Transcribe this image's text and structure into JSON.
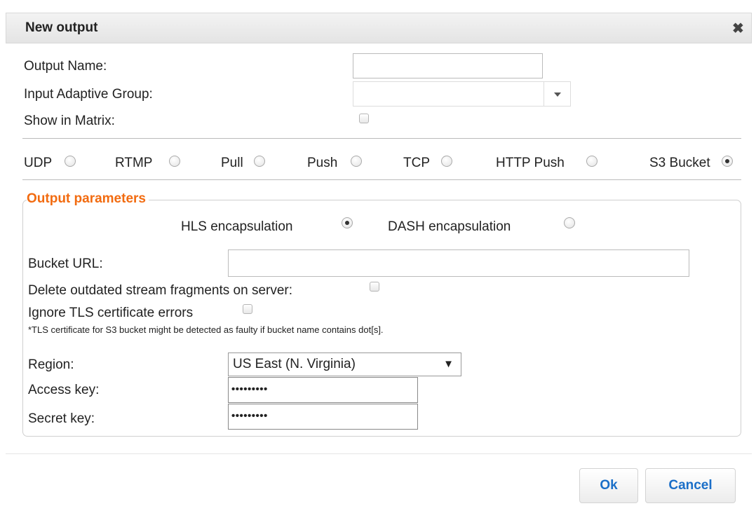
{
  "dialog": {
    "title": "New output",
    "close_icon": "close-icon"
  },
  "form": {
    "output_name_label": "Output Name:",
    "output_name_value": "",
    "input_adaptive_group_label": "Input Adaptive Group:",
    "input_adaptive_group_value": "",
    "show_in_matrix_label": "Show in Matrix:",
    "show_in_matrix_checked": false
  },
  "output_types": [
    {
      "label": "UDP",
      "checked": false
    },
    {
      "label": "RTMP",
      "checked": false
    },
    {
      "label": "Pull",
      "checked": false
    },
    {
      "label": "Push",
      "checked": false
    },
    {
      "label": "TCP",
      "checked": false
    },
    {
      "label": "HTTP Push",
      "checked": false
    },
    {
      "label": "S3 Bucket",
      "checked": true
    }
  ],
  "params": {
    "legend": "Output parameters",
    "hls_label": "HLS encapsulation",
    "hls_checked": true,
    "dash_label": "DASH encapsulation",
    "dash_checked": false,
    "bucket_url_label": "Bucket URL:",
    "bucket_url_value": "",
    "delete_fragments_label": "Delete outdated stream fragments on server:",
    "delete_fragments_checked": false,
    "ignore_tls_label": "Ignore TLS certificate errors",
    "ignore_tls_checked": false,
    "tls_note": "*TLS certificate for S3 bucket might be detected as faulty if bucket name contains dot[s].",
    "region_label": "Region:",
    "region_value": "US East (N. Virginia)",
    "access_key_label": "Access key:",
    "access_key_value": "•••••••••",
    "secret_key_label": "Secret key:",
    "secret_key_value": "•••••••••"
  },
  "buttons": {
    "ok": "Ok",
    "cancel": "Cancel"
  },
  "colors": {
    "legend": "#f26b10",
    "button_text": "#1b6fc8"
  }
}
